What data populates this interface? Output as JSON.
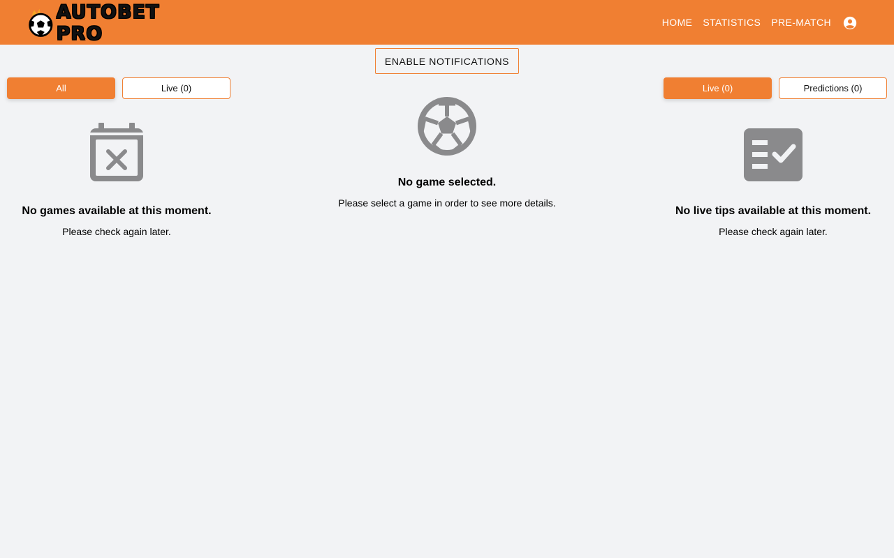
{
  "header": {
    "brand": "AUTOBET PRO",
    "nav": [
      {
        "label": "HOME"
      },
      {
        "label": "STATISTICS"
      },
      {
        "label": "PRE-MATCH"
      }
    ]
  },
  "notifications": {
    "button_label": "ENABLE NOTIFICATIONS"
  },
  "left_panel": {
    "tabs": [
      {
        "label": "All",
        "active": true
      },
      {
        "label": "Live (0)",
        "active": false
      }
    ],
    "empty_title": "No games available at this moment.",
    "empty_text": "Please check again later.",
    "icon": "calendar-x-icon"
  },
  "center_panel": {
    "empty_title": "No game selected.",
    "empty_text": "Please select a game in order to see more details.",
    "icon": "soccer-ball-icon"
  },
  "right_panel": {
    "tabs": [
      {
        "label": "Live (0)",
        "active": true
      },
      {
        "label": "Predictions (0)",
        "active": false
      }
    ],
    "empty_title": "No live tips available at this moment.",
    "empty_text": "Please check again later.",
    "icon": "checklist-icon"
  },
  "colors": {
    "accent": "#f07f32",
    "background": "#f2f3f5",
    "icon_gray": "#8a8a8c"
  }
}
